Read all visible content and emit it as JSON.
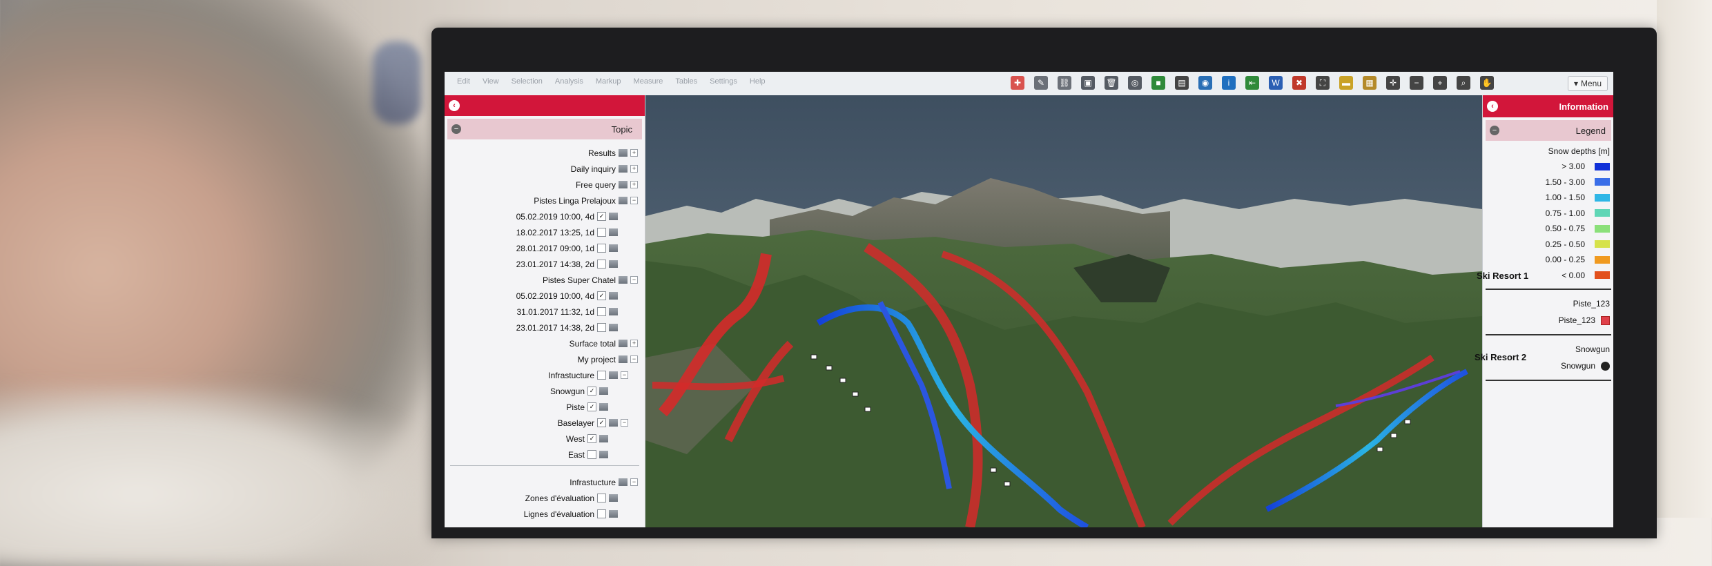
{
  "toolbar": {
    "menu_items": [
      "Edit",
      "View",
      "Selection",
      "Analysis",
      "Markup",
      "Measure",
      "Tables",
      "Settings",
      "Help"
    ],
    "menu_button_label": "Menu",
    "menu_chevron": "▾",
    "icons": [
      {
        "name": "lifebuoy-icon",
        "color": "#d9534f",
        "glyph": "✚"
      },
      {
        "name": "tools-icon",
        "color": "#6b7078",
        "glyph": "✎"
      },
      {
        "name": "link-icon",
        "color": "#6b7078",
        "glyph": "⛓"
      },
      {
        "name": "save-icon",
        "color": "#555b63",
        "glyph": "▣"
      },
      {
        "name": "trash-icon",
        "color": "#555b63",
        "glyph": "🗑"
      },
      {
        "name": "locate-icon",
        "color": "#555b63",
        "glyph": "◎"
      },
      {
        "name": "book-icon",
        "color": "#2f8a3a",
        "glyph": "■"
      },
      {
        "name": "print-icon",
        "color": "#444",
        "glyph": "▤"
      },
      {
        "name": "globe-icon",
        "color": "#2a6fb5",
        "glyph": "◉"
      },
      {
        "name": "info-icon",
        "color": "#1f6fbf",
        "glyph": "i"
      },
      {
        "name": "import-icon",
        "color": "#2f8a3a",
        "glyph": "⇤"
      },
      {
        "name": "word-icon",
        "color": "#2b5fb3",
        "glyph": "W"
      },
      {
        "name": "close-tool-icon",
        "color": "#c0392b",
        "glyph": "✖"
      },
      {
        "name": "fullscreen-icon",
        "color": "#444",
        "glyph": "⛶"
      },
      {
        "name": "folder-icon",
        "color": "#c9a227",
        "glyph": "▬"
      },
      {
        "name": "layers-icon",
        "color": "#b48a2a",
        "glyph": "▦"
      },
      {
        "name": "zoom-extent-icon",
        "color": "#444",
        "glyph": "✛"
      },
      {
        "name": "zoom-out-icon",
        "color": "#444",
        "glyph": "−"
      },
      {
        "name": "zoom-in-icon",
        "color": "#444",
        "glyph": "+"
      },
      {
        "name": "zoom-box-icon",
        "color": "#444",
        "glyph": "⌕"
      },
      {
        "name": "pan-hand-icon",
        "color": "#444",
        "glyph": "✋"
      }
    ]
  },
  "left_panel": {
    "header": "Topic",
    "collapse_glyph": "−",
    "tree": [
      {
        "label": "Results",
        "indent": 0,
        "checked": false,
        "toggle": "+"
      },
      {
        "label": "Daily inquiry",
        "indent": 0,
        "checked": false,
        "toggle": "+"
      },
      {
        "label": "Free query",
        "indent": 0,
        "checked": false,
        "toggle": "+"
      },
      {
        "label": "Pistes Linga Prelajoux",
        "indent": 0,
        "checked": false,
        "toggle": "−"
      },
      {
        "label": "05.02.2019 10:00, 4d",
        "indent": 1,
        "checked": true,
        "toggle": ""
      },
      {
        "label": "18.02.2017 13:25, 1d",
        "indent": 1,
        "checked": false,
        "toggle": ""
      },
      {
        "label": "28.01.2017 09:00, 1d",
        "indent": 1,
        "checked": false,
        "toggle": ""
      },
      {
        "label": "23.01.2017 14:38, 2d",
        "indent": 1,
        "checked": false,
        "toggle": ""
      },
      {
        "label": "Pistes Super Chatel",
        "indent": 0,
        "checked": false,
        "toggle": "−"
      },
      {
        "label": "05.02.2019 10:00, 4d",
        "indent": 1,
        "checked": true,
        "toggle": ""
      },
      {
        "label": "31.01.2017 11:32, 1d",
        "indent": 1,
        "checked": false,
        "toggle": ""
      },
      {
        "label": "23.01.2017 14:38, 2d",
        "indent": 1,
        "checked": false,
        "toggle": ""
      },
      {
        "label": "Surface total",
        "indent": 0,
        "checked": false,
        "toggle": "+"
      },
      {
        "label": "My project",
        "indent": 0,
        "checked": false,
        "toggle": "−"
      },
      {
        "label": "Infrastucture",
        "indent": 1,
        "checked": false,
        "toggle": "−"
      },
      {
        "label": "Snowgun",
        "indent": 2,
        "checked": true,
        "toggle": ""
      },
      {
        "label": "Piste",
        "indent": 2,
        "checked": true,
        "toggle": ""
      },
      {
        "label": "Baselayer",
        "indent": 1,
        "checked": true,
        "toggle": "−"
      },
      {
        "label": "West",
        "indent": 2,
        "checked": true,
        "toggle": ""
      },
      {
        "label": "East",
        "indent": 2,
        "checked": false,
        "toggle": ""
      }
    ],
    "tree2": [
      {
        "label": "Infrastucture",
        "indent": 0,
        "checked": false,
        "toggle": "−"
      },
      {
        "label": "Zones d'évaluation",
        "indent": 1,
        "checked": false,
        "toggle": ""
      },
      {
        "label": "Lignes d'évaluation",
        "indent": 1,
        "checked": false,
        "toggle": ""
      }
    ]
  },
  "right_panel": {
    "header": "Information",
    "legend_header": "Legend",
    "collapse_glyph": "−",
    "snow_title": "Snow depths [m]",
    "snow_classes": [
      {
        "label": "> 3.00",
        "color": "#1030d8"
      },
      {
        "label": "1.50 - 3.00",
        "color": "#3a6ee8"
      },
      {
        "label": "1.00 - 1.50",
        "color": "#2fb6e6"
      },
      {
        "label": "0.75 - 1.00",
        "color": "#5fd6b6"
      },
      {
        "label": "0.50 - 0.75",
        "color": "#8be07a"
      },
      {
        "label": "0.25 - 0.50",
        "color": "#d6e24a"
      },
      {
        "label": "0.00 - 0.25",
        "color": "#f09a20"
      },
      {
        "label": "< 0.00",
        "color": "#e2501c"
      }
    ],
    "piste_group": "Piste_123",
    "piste_item": "Piste_123",
    "snowgun_group": "Snowgun",
    "snowgun_item": "Snowgun",
    "resort_1": "Ski Resort 1",
    "resort_2": "Ski Resort 2"
  },
  "colors": {
    "accent_red": "#d2163a",
    "panel_header_pink": "#e8c8d0",
    "piste_red": "#d42a2a",
    "snow_blue": "#2b56e0"
  }
}
